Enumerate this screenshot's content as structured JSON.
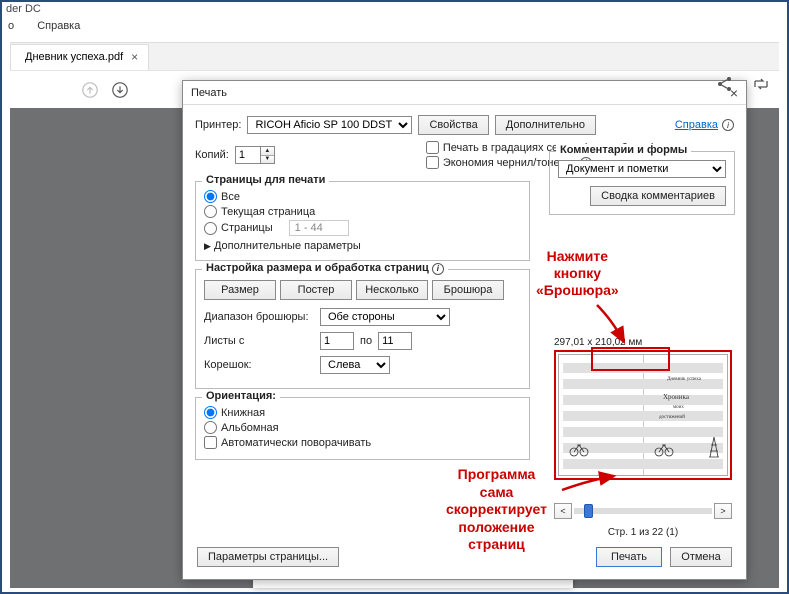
{
  "app": {
    "title_suffix": "der DC"
  },
  "menubar": {
    "item1": "о",
    "item2": "Справка"
  },
  "tab": {
    "label": "Дневник успеха.pdf"
  },
  "right_panel_icons": {
    "share": "share",
    "cycle": "cycle"
  },
  "dialog": {
    "title": "Печать",
    "printer_label": "Принтер:",
    "printer_value": "RICOH Aficio SP 100 DDST",
    "properties_btn": "Свойства",
    "advanced_btn": "Дополнительно",
    "help_link": "Справка",
    "copies_label": "Копий:",
    "copies_value": "1",
    "cb_grayscale": "Печать в градациях серого (черно-белая)",
    "cb_inksave": "Экономия чернил/тонера",
    "pages_legend": "Страницы для печати",
    "radio_all": "Все",
    "radio_current": "Текущая страница",
    "radio_range": "Страницы",
    "range_hint": "1 - 44",
    "more_params": "Дополнительные параметры",
    "size_legend": "Настройка размера и обработка страниц",
    "btn_size": "Размер",
    "btn_poster": "Постер",
    "btn_multiple": "Несколько",
    "btn_booklet": "Брошюра",
    "booklet_range_label": "Диапазон брошюры:",
    "booklet_range_value": "Обе стороны",
    "sheets_from_label": "Листы с",
    "sheets_from": "1",
    "sheets_to_label": "по",
    "sheets_to": "11",
    "binding_label": "Корешок:",
    "binding_value": "Слева",
    "orient_legend": "Ориентация:",
    "orient_portrait": "Книжная",
    "orient_landscape": "Альбомная",
    "cb_autorotate": "Автоматически поворачивать",
    "comments_legend": "Комментарии и формы",
    "comments_value": "Документ и пометки",
    "comments_summary_btn": "Сводка комментариев",
    "preview_size": "297,01 x 210,02 мм",
    "preview_pager": "Стр. 1 из 22 (1)",
    "page_setup_btn": "Параметры страницы...",
    "print_btn": "Печать",
    "cancel_btn": "Отмена",
    "preview_title": "Дневник успеха",
    "preview_script1": "Хроника",
    "preview_script2": "моих",
    "preview_script3": "достижений"
  },
  "annotations": {
    "a1_line1": "Нажмите",
    "a1_line2": "кнопку",
    "a1_line3": "«Брошюра»",
    "a2_line1": "Программа",
    "a2_line2": "сама",
    "a2_line3": "скорректирует",
    "a2_line4": "положение",
    "a2_line5": "страниц"
  }
}
